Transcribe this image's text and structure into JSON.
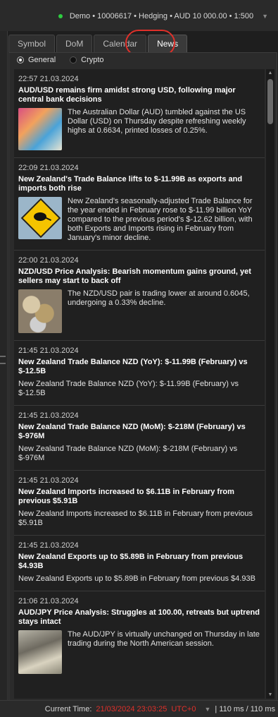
{
  "account": {
    "text": "Demo • 10006617 • Hedging • AUD 10 000.00 • 1:500",
    "status_color": "#2ecc40"
  },
  "tabs": [
    {
      "label": "Symbol"
    },
    {
      "label": "DoM"
    },
    {
      "label": "Calendar"
    },
    {
      "label": "News",
      "active": true
    }
  ],
  "filter": {
    "general": "General",
    "crypto": "Crypto",
    "selected": "General"
  },
  "news": [
    {
      "time": "22:57 21.03.2024",
      "title": "AUD/USD remains firm amidst strong USD, following major central bank decisions",
      "summary": "The Australian Dollar (AUD) tumbled against the US Dollar (USD) on Thursday despite refreshing weekly highs at 0.6634, printed losses of 0.25%.",
      "image": "aud-banknotes"
    },
    {
      "time": "22:09 21.03.2024",
      "title": "New Zealand's Trade Balance lifts to $-11.99B as exports and imports both rise",
      "summary": "New Zealand's seasonally-adjusted Trade Balance for the year ended in February rose to $-11.99 billion YoY compared to the previous period's $-12.62 billion, with both Exports and Imports rising in February from January's minor decline.",
      "image": "kiwi-road-sign"
    },
    {
      "time": "22:00 21.03.2024",
      "title": "NZD/USD Price Analysis: Bearish momentum gains ground, yet sellers may start to back off",
      "summary": "The NZD/USD pair is trading lower at around 0.6045, undergoing a 0.33% decline.",
      "image": "coins"
    },
    {
      "time": "21:45 21.03.2024",
      "title": "New Zealand Trade Balance NZD (YoY): $-11.99B (February) vs $-12.5B",
      "summary": "New Zealand Trade Balance NZD (YoY): $-11.99B (February) vs $-12.5B",
      "image": ""
    },
    {
      "time": "21:45 21.03.2024",
      "title": "New Zealand Trade Balance NZD (MoM): $-218M (February) vs $-976M",
      "summary": "New Zealand Trade Balance NZD (MoM): $-218M (February) vs $-976M",
      "image": ""
    },
    {
      "time": "21:45 21.03.2024",
      "title": "New Zealand Imports increased to $6.11B in February from previous $5.91B",
      "summary": "New Zealand Imports increased to $6.11B in February from previous $5.91B",
      "image": ""
    },
    {
      "time": "21:45 21.03.2024",
      "title": "New Zealand Exports up to $5.89B in February from previous $4.93B",
      "summary": "New Zealand Exports up to $5.89B in February from previous $4.93B",
      "image": ""
    },
    {
      "time": "21:06 21.03.2024",
      "title": "AUD/JPY Price Analysis: Struggles at 100.00, retreats but uptrend stays intact",
      "summary": "The AUD/JPY is virtually unchanged on Thursday in late trading during the North American session.",
      "image": "calculator-money"
    }
  ],
  "status": {
    "label": "Current Time:",
    "time": "21/03/2024 23:03:25",
    "tz": "UTC+0",
    "latency": "| 110 ms / 110 ms",
    "accent": "#e0302a"
  }
}
